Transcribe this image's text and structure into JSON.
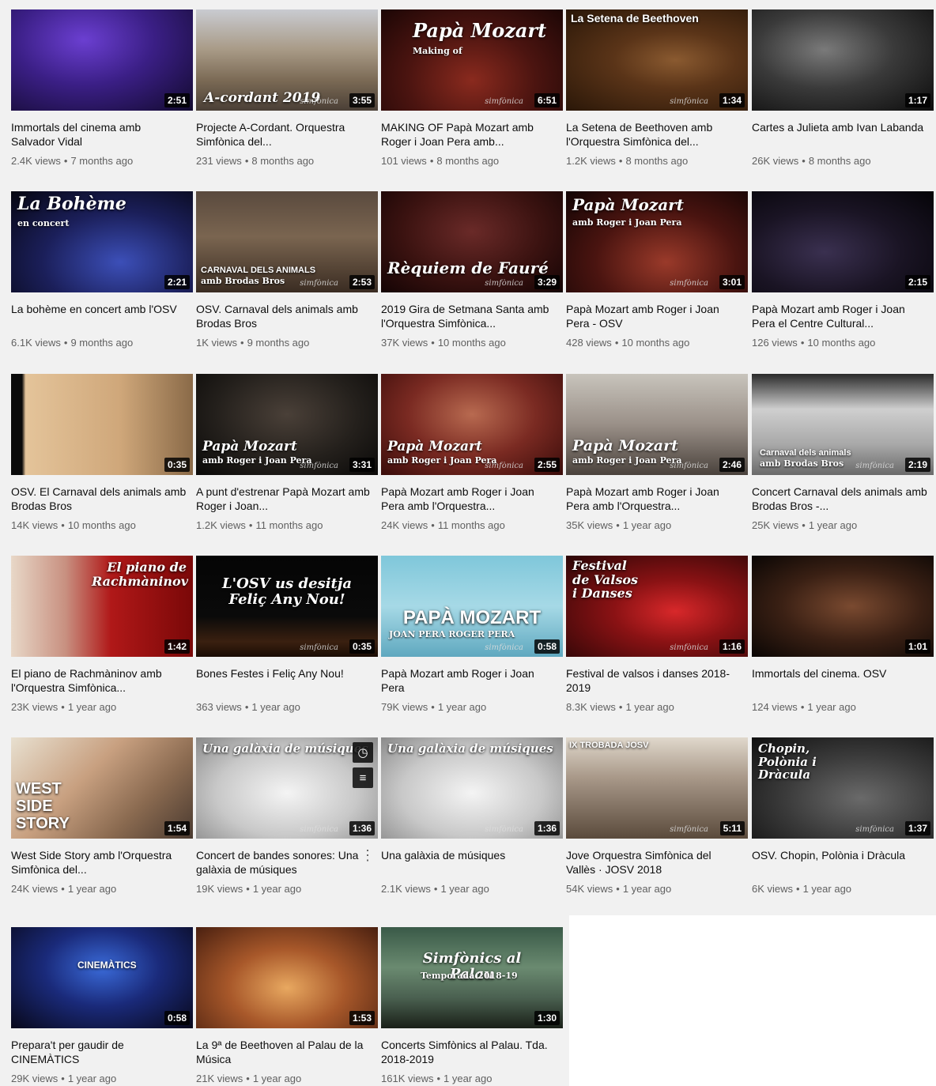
{
  "videos": [
    {
      "title": "Immortals del cinema amb Salvador Vidal",
      "views": "2.4K views",
      "age": "7 months ago",
      "duration": "2:51",
      "overlay": "",
      "sub": "",
      "bg": "radial-gradient(ellipse at 40% 30%, #6b3fd1 0%, #3b1f86 45%, #120a2e 100%)"
    },
    {
      "title": "Projecte A-Cordant. Orquestra Simfònica del...",
      "views": "231 views",
      "age": "8 months ago",
      "duration": "3:55",
      "overlay": "A-cordant 2019",
      "sub": "",
      "bg": "linear-gradient(180deg,#c9cbd1 0%,#a89a86 40%,#7b6a55 70%,#4a3f36 100%)"
    },
    {
      "title": "MAKING OF Papà Mozart amb Roger i Joan Pera amb...",
      "views": "101 views",
      "age": "8 months ago",
      "duration": "6:51",
      "overlay": "Papà Mozart",
      "sub": "Making of",
      "bg": "radial-gradient(ellipse at 50% 70%, #8a2a1e 0%, #4b1410 50%, #1c0605 100%)"
    },
    {
      "title": "La Setena de Beethoven amb l'Orquestra Simfònica del...",
      "views": "1.2K views",
      "age": "8 months ago",
      "duration": "1:34",
      "overlay": "La Setena de Beethoven",
      "sub": "",
      "bg": "radial-gradient(ellipse at 60% 50%, #8a5a30 0%, #5a3418 40%, #2a1708 100%)"
    },
    {
      "title": "Cartes a Julieta amb Ivan Labanda",
      "views": "26K views",
      "age": "8 months ago",
      "duration": "1:17",
      "overlay": "",
      "sub": "",
      "bg": "radial-gradient(ellipse at 40% 40%, #7a7a7a 0%, #3a3a3a 45%, #0c0c0c 100%)"
    },
    {
      "title": "La bohème en concert amb l'OSV",
      "views": "6.1K views",
      "age": "9 months ago",
      "duration": "2:21",
      "overlay": "La Bohème",
      "sub": "en concert",
      "bg": "radial-gradient(ellipse at 60% 70%, #3c4fb8 0%, #1b1f5a 50%, #05050f 100%)"
    },
    {
      "title": "OSV. Carnaval dels animals amb Brodas Bros",
      "views": "1K views",
      "age": "9 months ago",
      "duration": "2:53",
      "overlay": "CARNAVAL DELS ANIMALS",
      "sub": "amb Brodas Bros",
      "bg": "linear-gradient(180deg,#5a4a3e 0%,#7a6550 45%,#3a2c22 100%)"
    },
    {
      "title": "2019 Gira de Setmana Santa amb l'Orquestra Simfònica...",
      "views": "37K views",
      "age": "10 months ago",
      "duration": "3:29",
      "overlay": "Rèquiem de Fauré",
      "sub": "",
      "bg": "radial-gradient(ellipse at 50% 40%, #6a2a28 0%, #3a1210 55%, #140404 100%)"
    },
    {
      "title": "Papà Mozart amb Roger i Joan Pera - OSV",
      "views": "428 views",
      "age": "10 months ago",
      "duration": "3:01",
      "overlay": "Papà Mozart",
      "sub": "amb Roger i Joan Pera",
      "bg": "radial-gradient(ellipse at 55% 70%, #9a3a2a 0%, #4a1410 50%, #120404 100%)"
    },
    {
      "title": "Papà Mozart amb Roger i Joan Pera el Centre Cultural...",
      "views": "126 views",
      "age": "10 months ago",
      "duration": "2:15",
      "overlay": "",
      "sub": "",
      "bg": "radial-gradient(ellipse at 40% 60%, #3a3050 0%, #1a1424 50%, #050408 100%)"
    },
    {
      "title": "OSV. El Carnaval dels animals amb Brodas Bros",
      "views": "14K views",
      "age": "10 months ago",
      "duration": "0:35",
      "overlay": "",
      "sub": "",
      "bg": "linear-gradient(90deg,#0a0a0a 0%,#0a0a0a 6%,#e4c49a 8%,#cfa77a 60%,#8a6a48 100%)"
    },
    {
      "title": "A punt d'estrenar Papà Mozart amb Roger i Joan...",
      "views": "1.2K views",
      "age": "11 months ago",
      "duration": "3:31",
      "overlay": "Papà Mozart",
      "sub": "amb Roger i Joan Pera",
      "bg": "radial-gradient(ellipse at 50% 40%, #4a4038 0%, #24201c 55%, #0a0908 100%)"
    },
    {
      "title": "Papà Mozart amb Roger i Joan Pera amb l'Orquestra...",
      "views": "24K views",
      "age": "11 months ago",
      "duration": "2:55",
      "overlay": "Papà Mozart",
      "sub": "amb Roger i Joan Pera",
      "bg": "radial-gradient(ellipse at 50% 40%, #b86a50 0%, #7a2a22 50%, #3a0c0a 100%)"
    },
    {
      "title": "Papà Mozart amb Roger i Joan Pera amb l'Orquestra...",
      "views": "35K views",
      "age": "1 year ago",
      "duration": "2:46",
      "overlay": "Papà Mozart",
      "sub": "amb Roger i Joan Pera",
      "bg": "linear-gradient(180deg,#c8c4bc 0%,#9a9088 50%,#4a423c 100%)"
    },
    {
      "title": "Concert Carnaval dels animals amb Brodas Bros -...",
      "views": "25K views",
      "age": "1 year ago",
      "duration": "2:19",
      "overlay": "Carnaval dels animals",
      "sub": "amb Brodas Bros",
      "bg": "linear-gradient(180deg,#2a2a2a 0%,#cfcfcf 35%,#a8a8a8 70%,#6a6a6a 100%)"
    },
    {
      "title": "El piano de Rachmàninov amb l'Orquestra Simfònica...",
      "views": "23K views",
      "age": "1 year ago",
      "duration": "1:42",
      "overlay": "El piano de Rachmàninov",
      "sub": "",
      "bg": "linear-gradient(90deg,#e8d8c8 0%,#c89080 30%,#b01818 55%,#7a0808 100%)"
    },
    {
      "title": "Bones Festes i Feliç Any Nou!",
      "views": "363 views",
      "age": "1 year ago",
      "duration": "0:35",
      "overlay": "L'OSV us desitja Feliç Any Nou!",
      "sub": "",
      "bg": "linear-gradient(180deg,#050505 0%,#0a0a0a 60%,#3a2010 85%,#1a0c04 100%)"
    },
    {
      "title": "Papà Mozart amb Roger i Joan Pera",
      "views": "79K views",
      "age": "1 year ago",
      "duration": "0:58",
      "overlay": "PAPÀ MOZART",
      "sub": "JOAN PERA    ROGER PERA",
      "bg": "linear-gradient(180deg,#7fc7da 0%,#a6d9e6 50%,#5fa8bf 100%)"
    },
    {
      "title": "Festival de valsos i danses 2018-2019",
      "views": "8.3K views",
      "age": "1 year ago",
      "duration": "1:16",
      "overlay": "Festival de Valsos i Danses",
      "sub": "",
      "bg": "radial-gradient(ellipse at 60% 55%, #d8282a 0%, #8a1214 40%, #2a0606 100%)"
    },
    {
      "title": "Immortals del cinema. OSV",
      "views": "124 views",
      "age": "1 year ago",
      "duration": "1:01",
      "overlay": "",
      "sub": "",
      "bg": "radial-gradient(ellipse at 55% 50%, #7a4a30 0%, #3a2014 50%, #0a0604 100%)"
    },
    {
      "title": "West Side Story amb l'Orquestra Simfònica del...",
      "views": "24K views",
      "age": "1 year ago",
      "duration": "1:54",
      "overlay": "WEST SIDE STORY",
      "sub": "",
      "bg": "linear-gradient(135deg,#e8e0d0 0%,#c8a080 40%,#8a6a50 70%,#4a3a30 100%)"
    },
    {
      "title": "Concert de bandes sonores: Una galàxia de músiques",
      "views": "19K views",
      "age": "1 year ago",
      "duration": "1:36",
      "overlay": "Una galàxia de músiques",
      "sub": "",
      "bg": "radial-gradient(ellipse at 50% 55%, #f4f4f4 0%, #c8c8c8 55%, #8a8a8a 100%)"
    },
    {
      "title": "Una galàxia de músiques",
      "views": "2.1K views",
      "age": "1 year ago",
      "duration": "1:36",
      "overlay": "Una galàxia de músiques",
      "sub": "",
      "bg": "radial-gradient(ellipse at 50% 55%, #f4f4f4 0%, #c8c8c8 55%, #8a8a8a 100%)"
    },
    {
      "title": "Jove Orquestra Simfònica del Vallès · JOSV 2018",
      "views": "54K views",
      "age": "1 year ago",
      "duration": "5:11",
      "overlay": "IX TROBADA JOSV",
      "sub": "",
      "bg": "linear-gradient(180deg,#e0d8cc 0%,#a89888 40%,#5a4a3c 100%)"
    },
    {
      "title": "OSV. Chopin, Polònia i Dràcula",
      "views": "6K views",
      "age": "1 year ago",
      "duration": "1:37",
      "overlay": "Chopin, Polònia i Dràcula",
      "sub": "",
      "bg": "radial-gradient(ellipse at 60% 60%, #6a6a6a 0%, #3a3a3a 50%, #101010 100%)"
    },
    {
      "title": "Prepara't per gaudir de CINEMÀTICS",
      "views": "29K views",
      "age": "1 year ago",
      "duration": "0:58",
      "overlay": "CINEMÀTICS",
      "sub": "",
      "bg": "radial-gradient(ellipse at 50% 40%, #3a6ad8 0%, #1a2a7a 45%, #08081a 100%)"
    },
    {
      "title": "La 9ª de Beethoven al Palau de la Música",
      "views": "21K views",
      "age": "1 year ago",
      "duration": "1:53",
      "overlay": "",
      "sub": "",
      "bg": "radial-gradient(ellipse at 50% 60%, #e8a860 0%, #a8582a 45%, #4a2010 100%)"
    },
    {
      "title": "Concerts Simfònics al Palau. Tda. 2018-2019",
      "views": "161K views",
      "age": "1 year ago",
      "duration": "1:30",
      "overlay": "Simfònics al Palau",
      "sub": "Temporada 2018-19",
      "bg": "linear-gradient(180deg,#3a5a48 0%,#6a8a70 40%,#4a6050 70%,#1a2018 100%)"
    }
  ],
  "brand_text": "simfònica",
  "dot": "•"
}
